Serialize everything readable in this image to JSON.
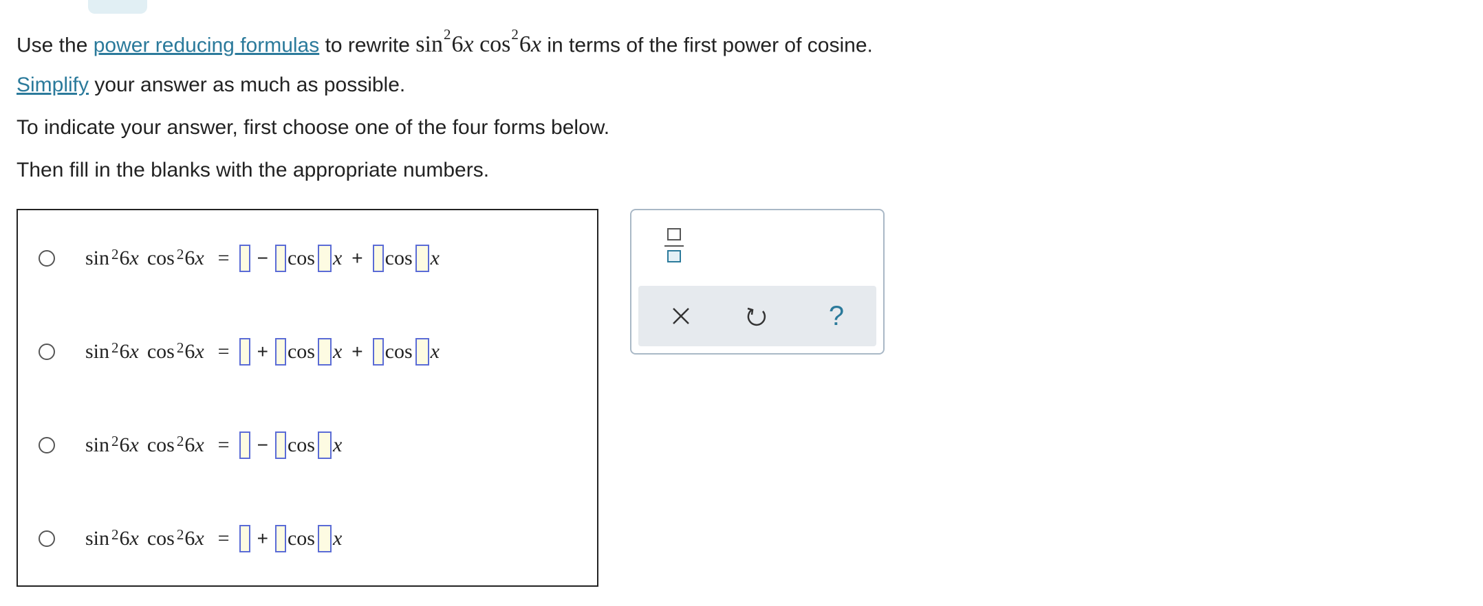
{
  "prompt": {
    "line1_pre": "Use the ",
    "line1_link": "power reducing formulas",
    "line1_mid": " to rewrite ",
    "line1_post": " in terms of the first power of cosine.",
    "line2_link": "Simplify",
    "line2_post": " your answer as much as possible.",
    "line3": "To indicate your answer, first choose one of the four forms below.",
    "line4": "Then fill in the blanks with the appropriate numbers."
  },
  "expr": {
    "sin": "sin",
    "cos": "cos",
    "exp": "2",
    "arg_num": "6",
    "var": "x",
    "equals": "=",
    "minus": "−",
    "plus": "+"
  },
  "choices": [
    {
      "label": "form-1",
      "lead_op": "−",
      "terms": 2,
      "second_op": "+"
    },
    {
      "label": "form-2",
      "lead_op": "+",
      "terms": 2,
      "second_op": "+"
    },
    {
      "label": "form-3",
      "lead_op": "−",
      "terms": 1,
      "second_op": ""
    },
    {
      "label": "form-4",
      "lead_op": "+",
      "terms": 1,
      "second_op": ""
    }
  ],
  "toolbar": {
    "fraction_icon": "fraction-icon",
    "clear_icon": "x-icon",
    "undo_icon": "undo-icon",
    "help_label": "?"
  },
  "colors": {
    "link": "#2b7a9b",
    "blank_border": "#5a6bd6",
    "blank_fill": "#fdfbe2",
    "toolbar_border": "#a9b8c6",
    "action_bar": "#e6eaee"
  }
}
